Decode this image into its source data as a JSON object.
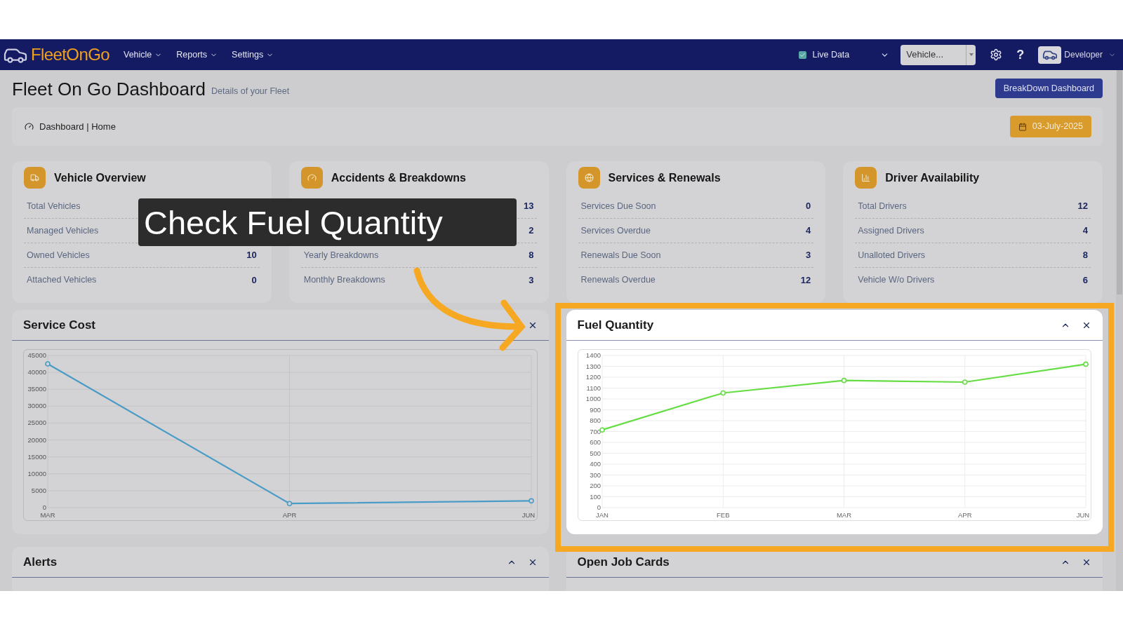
{
  "navbar": {
    "logo": "FleetOnGo",
    "menus": [
      {
        "label": "Vehicle"
      },
      {
        "label": "Reports"
      },
      {
        "label": "Settings"
      }
    ],
    "live_data": {
      "label": "Live Data",
      "checked": true
    },
    "vehicle_select": {
      "value": "Vehicle..."
    },
    "help": "?",
    "user": "Developer"
  },
  "header": {
    "title": "Fleet On Go Dashboard",
    "subtitle": "Details of your Fleet",
    "button": "BreakDown Dashboard"
  },
  "breadcrumb": {
    "text": "Dashboard | Home",
    "date": "03-July-2025"
  },
  "cards": [
    {
      "title": "Vehicle Overview",
      "kind": "truck",
      "rows": [
        {
          "label": "Total Vehicles"
        },
        {
          "label": "Managed Vehicles"
        },
        {
          "label": "Owned Vehicles",
          "value": "10"
        },
        {
          "label": "Attached Vehicles",
          "value": "0"
        }
      ]
    },
    {
      "title": "Accidents & Breakdowns",
      "kind": "gauge",
      "rows": [
        {
          "value": "13"
        },
        {
          "value": "2"
        },
        {
          "label": "Yearly Breakdowns",
          "value": "8"
        },
        {
          "label": "Monthly Breakdowns",
          "value": "3"
        }
      ]
    },
    {
      "title": "Services & Renewals",
      "kind": "globe",
      "rows": [
        {
          "label": "Services Due Soon",
          "value": "0"
        },
        {
          "label": "Services Overdue",
          "value": "4"
        },
        {
          "label": "Renewals Due Soon",
          "value": "3"
        },
        {
          "label": "Renewals Overdue",
          "value": "12"
        }
      ]
    },
    {
      "title": "Driver Availability",
      "kind": "chart",
      "rows": [
        {
          "label": "Total Drivers",
          "value": "12"
        },
        {
          "label": "Assigned Drivers",
          "value": "4"
        },
        {
          "label": "Unalloted Drivers",
          "value": "8"
        },
        {
          "label": "Vehicle W/o Drivers",
          "value": "6"
        }
      ]
    }
  ],
  "service_cost": {
    "title": "Service Cost",
    "closable": true,
    "chart_data": {
      "type": "line",
      "grid": true,
      "categories": [
        "MAR",
        "APR",
        "JUN"
      ],
      "series": [
        {
          "color": "#4a9cc7",
          "marker": true,
          "values": [
            42500,
            1200,
            2000
          ]
        }
      ],
      "ylim": [
        0,
        45000
      ],
      "yticks": [
        0,
        5000,
        10000,
        15000,
        20000,
        25000,
        30000,
        35000,
        40000,
        45000
      ]
    }
  },
  "fuel_quantity": {
    "title": "Fuel Quantity",
    "collapsible": true,
    "closable": true,
    "chart_data": {
      "type": "line",
      "grid": true,
      "categories": [
        "JAN",
        "FEB",
        "MAR",
        "APR",
        "JUN"
      ],
      "series": [
        {
          "color": "#66dd44",
          "marker": true,
          "values": [
            715,
            1055,
            1170,
            1155,
            1320
          ]
        }
      ],
      "ylim": [
        0,
        1400
      ],
      "yticks": [
        0,
        100,
        200,
        300,
        400,
        500,
        600,
        700,
        800,
        900,
        1000,
        1100,
        1200,
        1300,
        1400
      ]
    }
  },
  "alerts": {
    "title": "Alerts",
    "collapsible": true,
    "closable": true
  },
  "open_job_cards": {
    "title": "Open Job Cards",
    "collapsible": true,
    "closable": true
  },
  "callout": {
    "text": "Check Fuel Quantity"
  }
}
